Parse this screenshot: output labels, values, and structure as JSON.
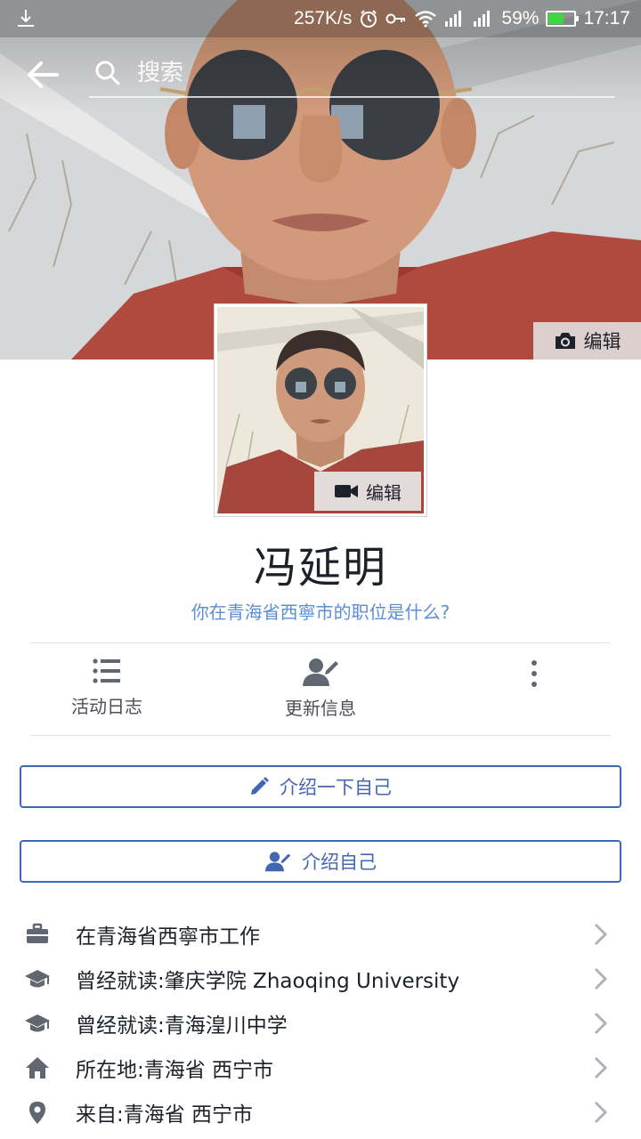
{
  "status_bar": {
    "net_speed": "257K/s",
    "battery_percent": "59%",
    "battery_level": 0.59,
    "time": "17:17"
  },
  "search": {
    "placeholder": "搜索"
  },
  "cover": {
    "edit_label": "编辑"
  },
  "avatar": {
    "edit_label": "编辑"
  },
  "profile": {
    "name": "冯延明",
    "job_prompt": "你在青海省西寧市的职位是什么?"
  },
  "actions": [
    {
      "label": "活动日志",
      "icon": "list-icon"
    },
    {
      "label": "更新信息",
      "icon": "edit-profile-icon"
    },
    {
      "label": "",
      "icon": "more-vertical-icon"
    }
  ],
  "buttons": {
    "intro_one": "介绍一下自己",
    "intro_two": "介绍自己"
  },
  "info": [
    {
      "icon": "briefcase-icon",
      "text": "在青海省西寧市工作"
    },
    {
      "icon": "graduation-cap-icon",
      "text": "曾经就读:肇庆学院 Zhaoqing University"
    },
    {
      "icon": "graduation-cap-icon",
      "text": "曾经就读:青海湟川中学"
    },
    {
      "icon": "home-icon",
      "text": "所在地:青海省 西宁市"
    },
    {
      "icon": "location-pin-icon",
      "text": "来自:青海省 西宁市"
    }
  ],
  "colors": {
    "accent": "#4267b2",
    "link": "#5b8fd3",
    "text": "#1d2129",
    "secondary_text": "#4b4f56",
    "icon_gray": "#606770",
    "battery_green": "#3ed83e"
  }
}
